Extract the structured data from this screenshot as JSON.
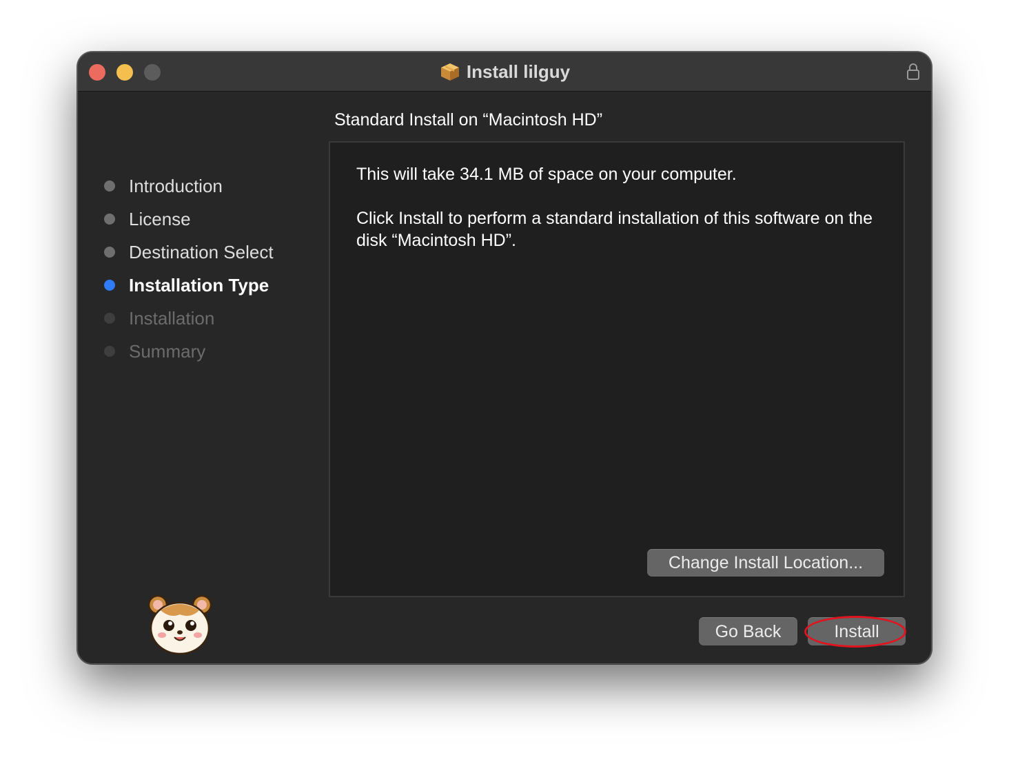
{
  "window": {
    "title": "Install lilguy",
    "title_icon": "package-icon",
    "lock_icon": "lock-icon"
  },
  "steps": [
    {
      "label": "Introduction",
      "state": "done"
    },
    {
      "label": "License",
      "state": "done"
    },
    {
      "label": "Destination Select",
      "state": "done"
    },
    {
      "label": "Installation Type",
      "state": "current"
    },
    {
      "label": "Installation",
      "state": "future"
    },
    {
      "label": "Summary",
      "state": "future"
    }
  ],
  "pane": {
    "heading": "Standard Install on “Macintosh HD”",
    "space_message": "This will take 34.1 MB of space on your computer.",
    "install_message": "Click Install to perform a standard installation of this software on the disk “Macintosh HD”.",
    "change_location_label": "Change Install Location..."
  },
  "buttons": {
    "go_back": "Go Back",
    "install": "Install"
  },
  "colors": {
    "accent": "#2f7cf6",
    "close": "#ec6b5f",
    "minimize": "#f4bf4f",
    "zoom_disabled": "#5c5c5c",
    "highlight": "#e0141e"
  }
}
